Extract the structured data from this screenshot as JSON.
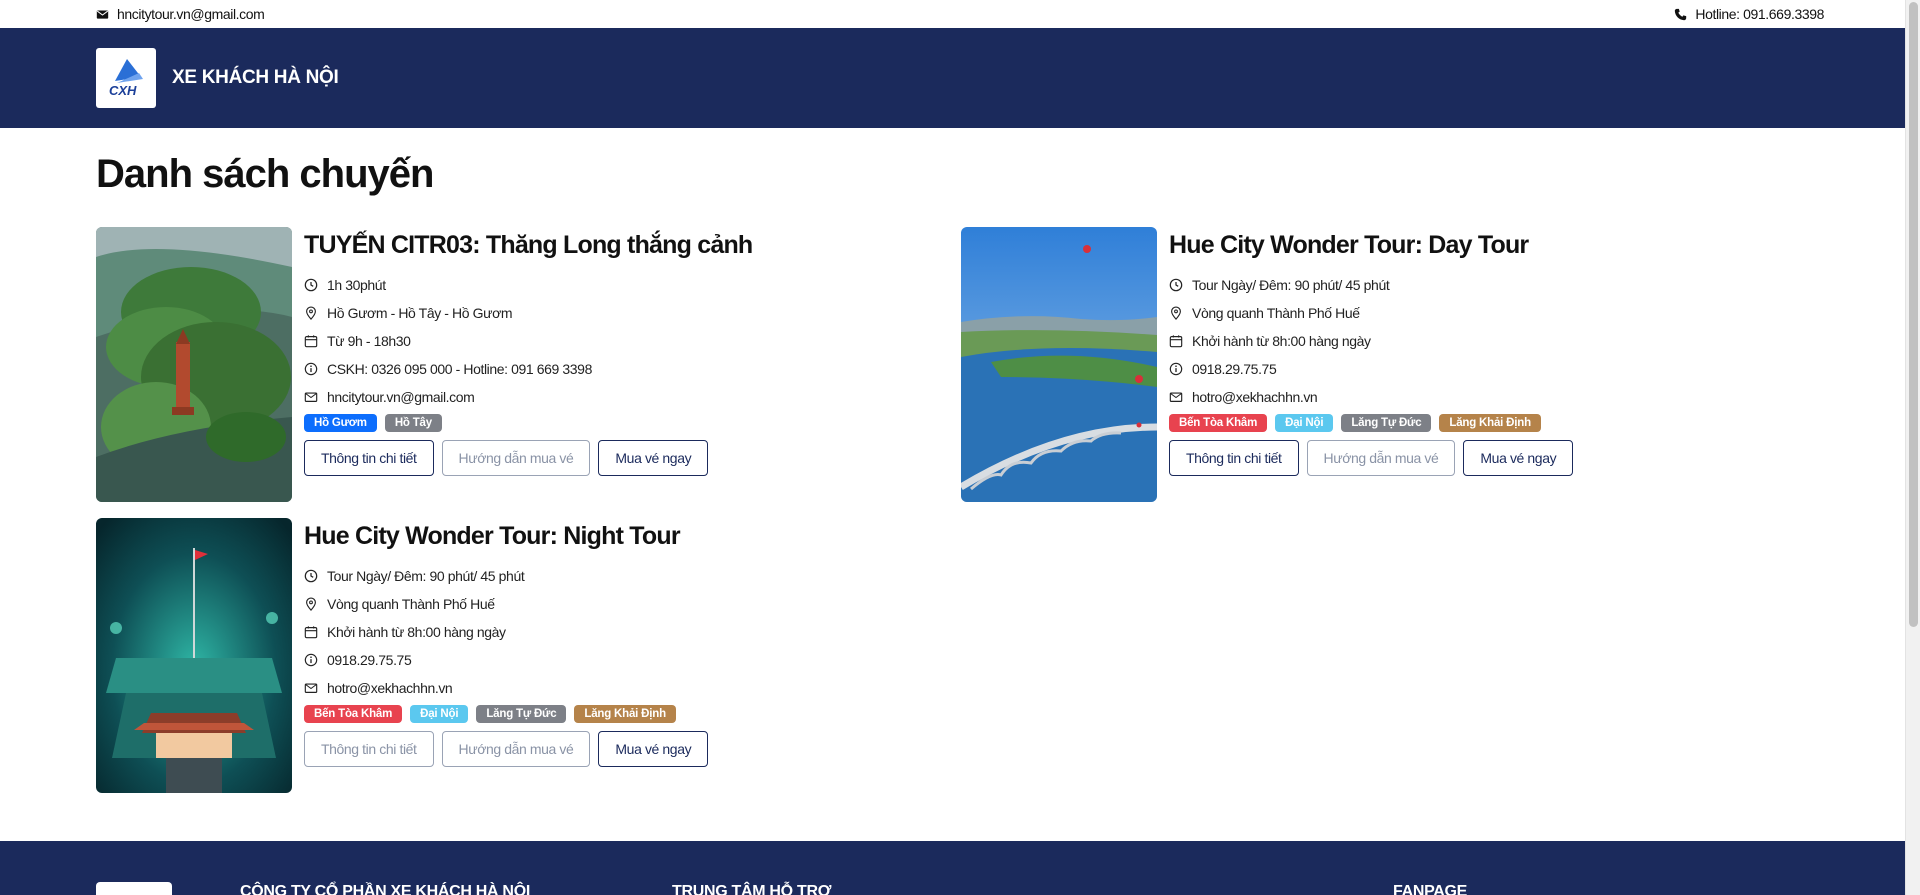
{
  "topbar": {
    "email": "hncitytour.vn@gmail.com",
    "hotline": "Hotline: 091.669.3398"
  },
  "header": {
    "logo_text": "CXH",
    "brand": "XE KHÁCH HÀ NỘI"
  },
  "page": {
    "title": "Danh sách chuyến"
  },
  "colors": {
    "navy": "#1b2a5c",
    "tag_blue": "#0d6efd",
    "tag_gray": "#6c757d",
    "tag_red": "#dc3545",
    "tag_cyan": "#0dcaf0",
    "tag_brown": "#b5834a"
  },
  "tours": [
    {
      "title": "TUYẾN CITR03: Thăng Long thắng cảnh",
      "duration": "1h 30phút",
      "route": "Hồ Gươm - Hồ Tây - Hồ Gươm",
      "schedule": "Từ 9h - 18h30",
      "contact": "CSKH: 0326 095 000 - Hotline: 091 669 3398",
      "email": "hncitytour.vn@gmail.com",
      "tags": [
        {
          "label": "Hồ Gươm",
          "color": "#0d6efd"
        },
        {
          "label": "Hồ Tây",
          "color": "#7d8087"
        }
      ],
      "buttons": {
        "detail": "Thông tin chi tiết",
        "guide": "Hướng dẫn mua vé",
        "buy": "Mua vé ngay"
      }
    },
    {
      "title": "Hue City Wonder Tour: Day Tour",
      "duration": "Tour Ngày/ Đêm: 90 phút/ 45 phút",
      "route": "Vòng quanh Thành Phố Huế",
      "schedule": "Khởi hành từ 8h:00 hàng ngày",
      "contact": "0918.29.75.75",
      "email": "hotro@xekhachhn.vn",
      "tags": [
        {
          "label": "Bến Tòa Khâm",
          "color": "#e8434f"
        },
        {
          "label": "Đại Nội",
          "color": "#5bc8ef"
        },
        {
          "label": "Lăng Tự Đức",
          "color": "#7d8087"
        },
        {
          "label": "Lăng Khải Định",
          "color": "#b5834a"
        }
      ],
      "buttons": {
        "detail": "Thông tin chi tiết",
        "guide": "Hướng dẫn mua vé",
        "buy": "Mua vé ngay"
      }
    },
    {
      "title": "Hue City Wonder Tour: Night Tour",
      "duration": "Tour Ngày/ Đêm: 90 phút/ 45 phút",
      "route": "Vòng quanh Thành Phố Huế",
      "schedule": "Khởi hành từ 8h:00 hàng ngày",
      "contact": "0918.29.75.75",
      "email": "hotro@xekhachhn.vn",
      "tags": [
        {
          "label": "Bến Tòa Khâm",
          "color": "#e8434f"
        },
        {
          "label": "Đại Nội",
          "color": "#5bc8ef"
        },
        {
          "label": "Lăng Tự Đức",
          "color": "#7d8087"
        },
        {
          "label": "Lăng Khải Định",
          "color": "#b5834a"
        }
      ],
      "buttons": {
        "detail": "Thông tin chi tiết",
        "guide": "Hướng dẫn mua vé",
        "buy": "Mua vé ngay"
      }
    }
  ],
  "footer": {
    "company": "CÔNG TY CỔ PHẦN XE KHÁCH HÀ NỘI",
    "support": "TRUNG TÂM HỖ TRỢ",
    "fanpage": "FANPAGE"
  }
}
